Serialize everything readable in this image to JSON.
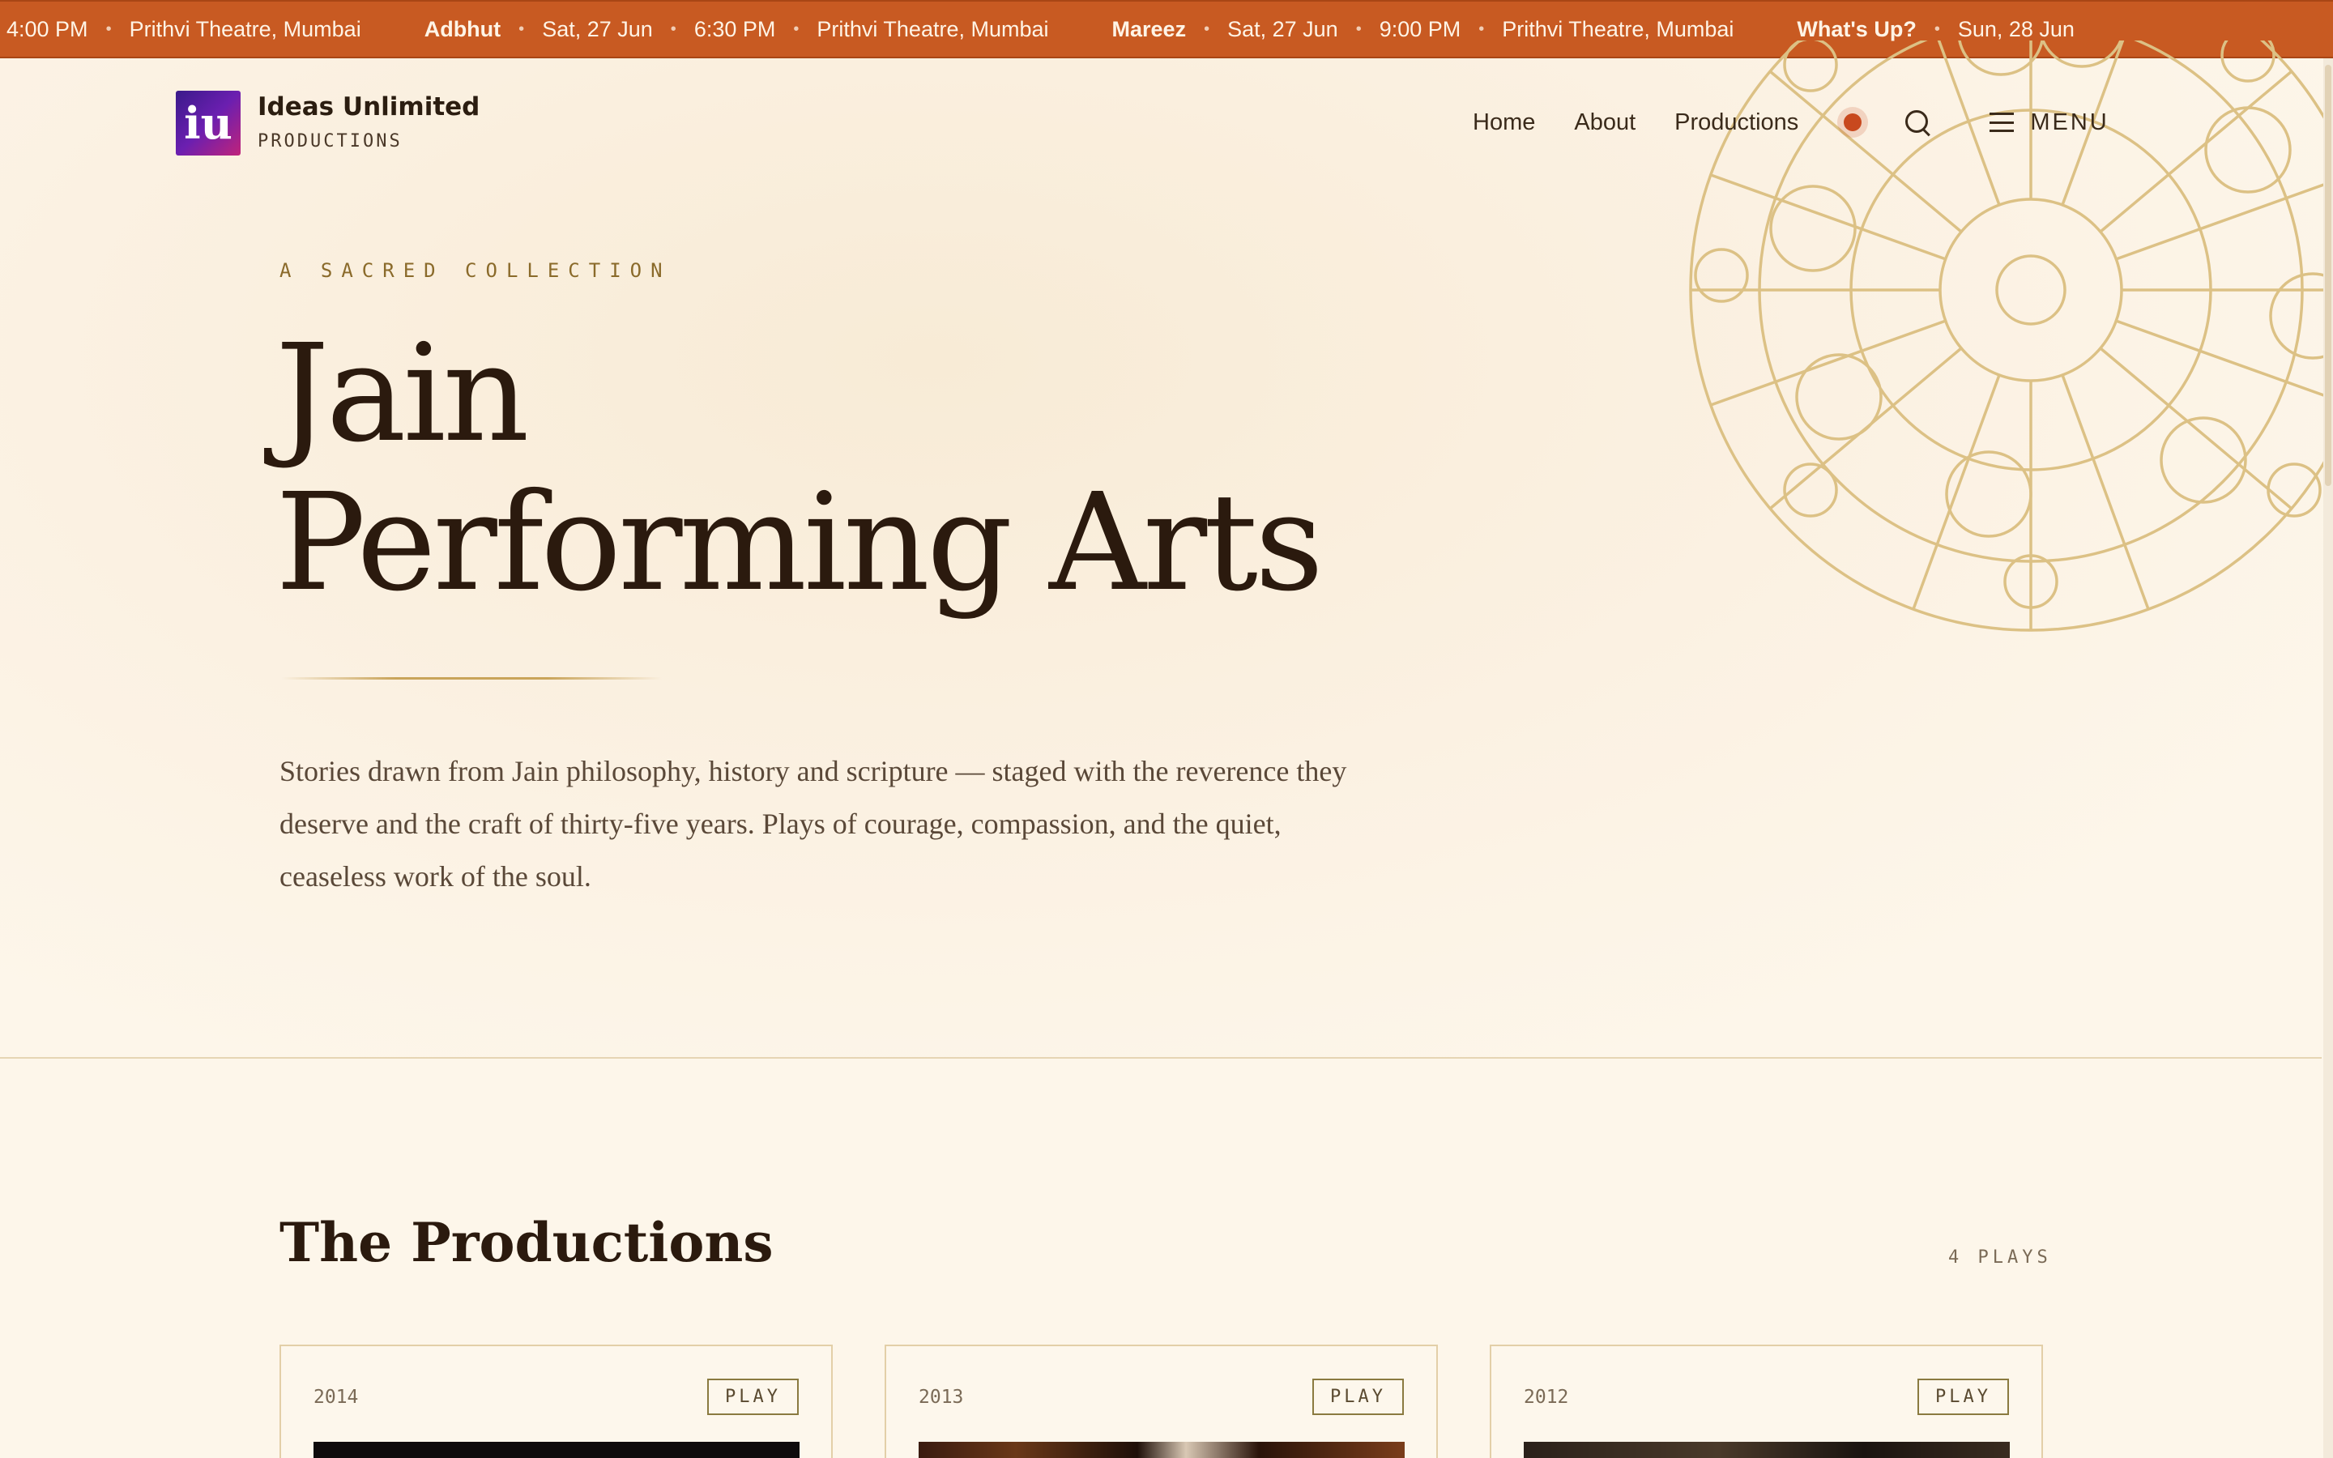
{
  "ticker": [
    {
      "title": "",
      "date": "",
      "time": "4:00 PM",
      "venue": "Prithvi Theatre, Mumbai"
    },
    {
      "title": "Adbhut",
      "date": "Sat, 27 Jun",
      "time": "6:30 PM",
      "venue": "Prithvi Theatre, Mumbai"
    },
    {
      "title": "Mareez",
      "date": "Sat, 27 Jun",
      "time": "9:00 PM",
      "venue": "Prithvi Theatre, Mumbai"
    },
    {
      "title": "What's Up?",
      "date": "Sun, 28 Jun",
      "time": "",
      "venue": ""
    }
  ],
  "header": {
    "logo_letter": "iu",
    "brand_name": "Ideas Unlimited",
    "brand_sub": "PRODUCTIONS",
    "nav": [
      "Home",
      "About",
      "Productions"
    ],
    "menu_label": "MENU"
  },
  "hero": {
    "eyebrow": "A SACRED COLLECTION",
    "title_line1": "Jain",
    "title_line2": "Performing Arts",
    "description": "Stories drawn from Jain philosophy, history and scripture — staged with the reverence they deserve and the craft of thirty-five years. Plays of courage, compassion, and the quiet, ceaseless work of the soul."
  },
  "productions": {
    "title": "The Productions",
    "count": "4 PLAYS",
    "cards": [
      {
        "year": "2014",
        "tag": "PLAY"
      },
      {
        "year": "2013",
        "tag": "PLAY"
      },
      {
        "year": "2012",
        "tag": "PLAY"
      }
    ]
  },
  "colors": {
    "accent": "#c85a22",
    "background": "#fdf6ea",
    "gold": "#c9a45a",
    "text": "#2b1a0e"
  }
}
